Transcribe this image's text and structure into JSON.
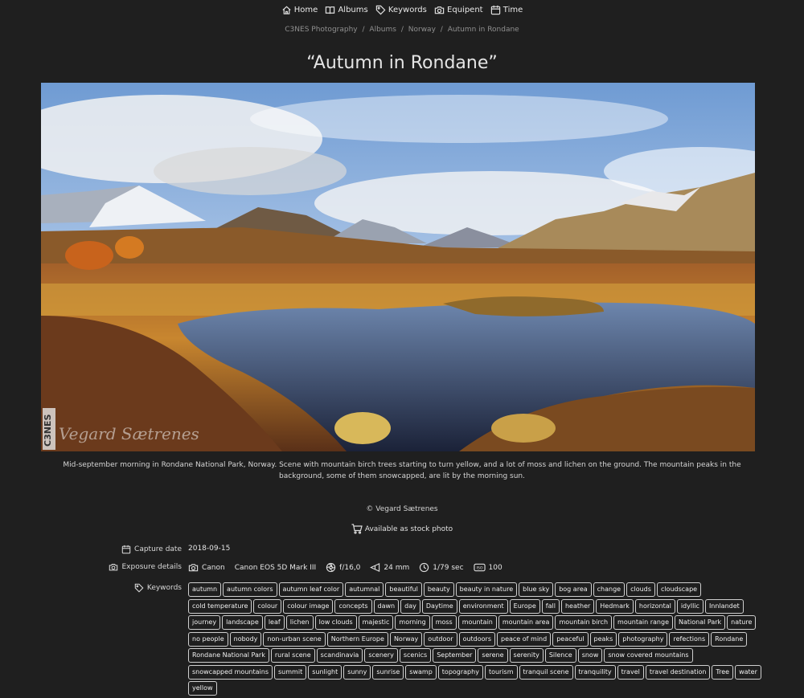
{
  "nav": {
    "items": [
      {
        "label": "Home",
        "icon": "home-icon"
      },
      {
        "label": "Albums",
        "icon": "book-icon"
      },
      {
        "label": "Keywords",
        "icon": "tag-icon"
      },
      {
        "label": "Equipent",
        "icon": "camera-icon"
      },
      {
        "label": "Time",
        "icon": "calendar-icon"
      }
    ]
  },
  "breadcrumb": {
    "items": [
      "C3NES Photography",
      "Albums",
      "Norway",
      "Autumn in Rondane"
    ],
    "separator": "/"
  },
  "page": {
    "title": "“Autumn in Rondane”",
    "caption": "Mid-september morning in Rondane National Park, Norway. Scene with mountain birch trees starting to turn yellow, and a lot of moss and lichen on the ground. The mountain peaks in the background, some of them snowcapped, are lit by the morning sun.",
    "copyright": "© Vegard Sætrenes",
    "stock_label": "Available as stock photo"
  },
  "photo": {
    "watermark_logo": "C3NES",
    "watermark_signature": "Vegard Sætrenes"
  },
  "details": {
    "capture_label": "Capture date",
    "capture_date": "2018-09-15",
    "exposure_label": "Exposure details",
    "make": "Canon",
    "model": "Canon EOS 5D Mark III",
    "aperture": "f/16,0",
    "focal": "24 mm",
    "shutter": "1/79 sec",
    "iso_icon_text": "ISO",
    "iso": "100",
    "keywords_label": "Keywords"
  },
  "keywords": [
    "autumn",
    "autumn colors",
    "autumn leaf color",
    "autumnal",
    "beautiful",
    "beauty",
    "beauty in nature",
    "blue sky",
    "bog area",
    "change",
    "clouds",
    "cloudscape",
    "cold temperature",
    "colour",
    "colour image",
    "concepts",
    "dawn",
    "day",
    "Daytime",
    "environment",
    "Europe",
    "fall",
    "heather",
    "Hedmark",
    "horizontal",
    "idyllic",
    "Innlandet",
    "journey",
    "landscape",
    "leaf",
    "lichen",
    "low clouds",
    "majestic",
    "morning",
    "moss",
    "mountain",
    "mountain area",
    "mountain birch",
    "mountain range",
    "National Park",
    "nature",
    "no people",
    "nobody",
    "non-urban scene",
    "Northern Europe",
    "Norway",
    "outdoor",
    "outdoors",
    "peace of mind",
    "peaceful",
    "peaks",
    "photography",
    "refections",
    "Rondane",
    "Rondane National Park",
    "rural scene",
    "scandinavia",
    "scenery",
    "scenics",
    "September",
    "serene",
    "serenity",
    "Silence",
    "snow",
    "snow covered mountains",
    "snowcapped mountains",
    "summit",
    "sunlight",
    "sunny",
    "sunrise",
    "swamp",
    "topography",
    "tourism",
    "tranquil scene",
    "tranquility",
    "travel",
    "travel destination",
    "Tree",
    "water",
    "yellow"
  ],
  "colors": {
    "background": "#1f1f1f",
    "text": "#e6e6e6",
    "muted": "#8f8f8f"
  }
}
